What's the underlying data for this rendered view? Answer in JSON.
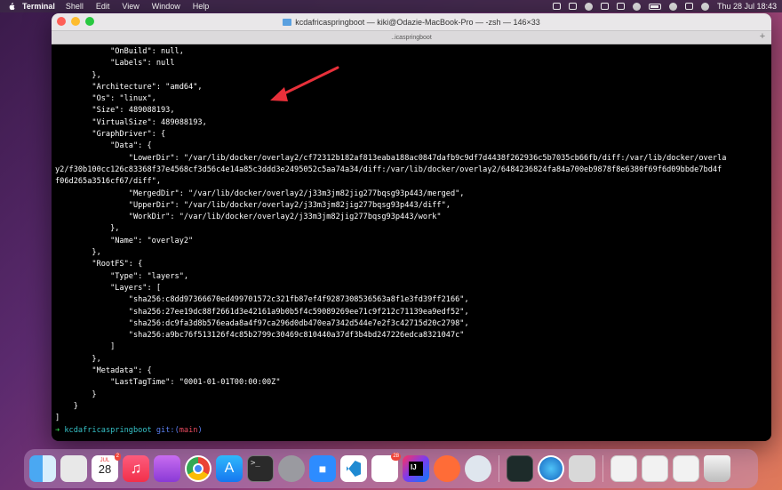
{
  "menubar": {
    "app_name": "Terminal",
    "items": [
      "Shell",
      "Edit",
      "View",
      "Window",
      "Help"
    ],
    "clock": "Thu 28 Jul  18:43"
  },
  "window": {
    "title": "kcdafricaspringboot — kiki@Odazie-MacBook-Pro — -zsh — 146×33",
    "tab_label": "..icaspringboot"
  },
  "terminal": {
    "lines": [
      "            \"OnBuild\": null,",
      "            \"Labels\": null",
      "        },",
      "        \"Architecture\": \"amd64\",",
      "        \"Os\": \"linux\",",
      "        \"Size\": 489088193,",
      "        \"VirtualSize\": 489088193,",
      "        \"GraphDriver\": {",
      "            \"Data\": {",
      "                \"LowerDir\": \"/var/lib/docker/overlay2/cf72312b182af813eaba188ac0847dafb9c9df7d4438f262936c5b7035cb66fb/diff:/var/lib/docker/overla",
      "y2/f30b100cc126c83368f37e4568cf3d56c4e14a85c3ddd3e2495052c5aa74a34/diff:/var/lib/docker/overlay2/6484236824fa84a700eb9878f8e6380f69f6d09bbde7bd4f",
      "f06d265a3516cf67/diff\",",
      "                \"MergedDir\": \"/var/lib/docker/overlay2/j33m3jm82jig277bqsg93p443/merged\",",
      "                \"UpperDir\": \"/var/lib/docker/overlay2/j33m3jm82jig277bqsg93p443/diff\",",
      "                \"WorkDir\": \"/var/lib/docker/overlay2/j33m3jm82jig277bqsg93p443/work\"",
      "            },",
      "            \"Name\": \"overlay2\"",
      "        },",
      "        \"RootFS\": {",
      "            \"Type\": \"layers\",",
      "            \"Layers\": [",
      "                \"sha256:c8dd97366670ed499701572c321fb87ef4f9287308536563a8f1e3fd39ff2166\",",
      "                \"sha256:27ee19dc88f2661d3e42161a9b0b5f4c59089269ee71c9f212c71139ea9edf52\",",
      "                \"sha256:dc9fa3d8b576eada8a4f97ca296d0db470ea7342d544e7e2f3c42715d20c2798\",",
      "                \"sha256:a9bc76f513126f4c85b2799c30469c810440a37df3b4bd247226edca8321047c\"",
      "            ]",
      "        },",
      "        \"Metadata\": {",
      "            \"LastTagTime\": \"0001-01-01T00:00:00Z\"",
      "        }",
      "    }",
      "]"
    ],
    "prompt": {
      "arrow": "➜",
      "dir": "kcdafricaspringboot",
      "git": "git:(",
      "branch": "main",
      "git_close": ")"
    }
  },
  "annotation": {
    "arrow_color": "#e8303a"
  },
  "dock": {
    "calendar_month": "JUL",
    "calendar_day": "28",
    "calendar_badge": "2",
    "slack_badge": "28",
    "music_glyph": "♫",
    "appstore_glyph": "A",
    "terminal_glyph": ">_",
    "zoom_glyph": "■"
  }
}
